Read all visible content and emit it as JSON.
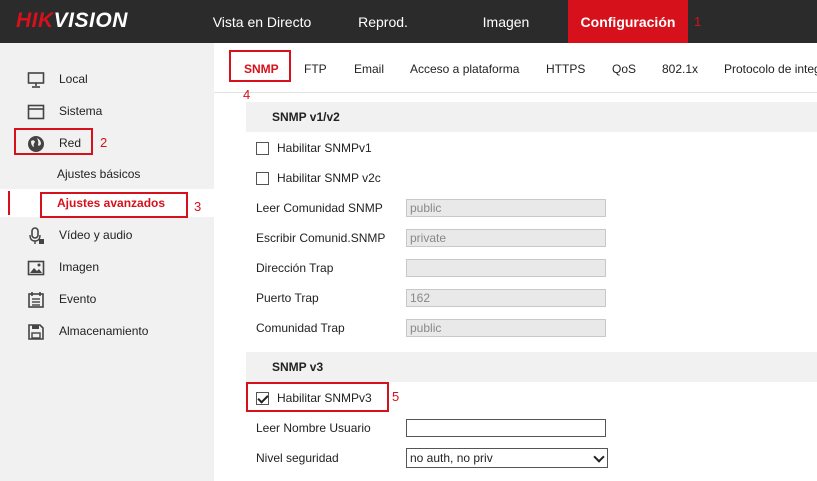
{
  "header": {
    "logo_red": "HIK",
    "logo_white": "VISION",
    "nav": [
      {
        "label": "Vista en Directo"
      },
      {
        "label": "Reprod."
      },
      {
        "label": "Imagen"
      },
      {
        "label": "Configuración"
      }
    ]
  },
  "annotations": [
    "1",
    "2",
    "3",
    "4",
    "5"
  ],
  "sidebar": {
    "items": [
      {
        "label": "Local"
      },
      {
        "label": "Sistema"
      },
      {
        "label": "Red"
      },
      {
        "label": "Vídeo y audio"
      },
      {
        "label": "Imagen"
      },
      {
        "label": "Evento"
      },
      {
        "label": "Almacenamiento"
      }
    ],
    "subitems": [
      {
        "label": "Ajustes básicos"
      },
      {
        "label": "Ajustes avanzados"
      }
    ]
  },
  "tabs": [
    {
      "label": "SNMP"
    },
    {
      "label": "FTP"
    },
    {
      "label": "Email"
    },
    {
      "label": "Acceso a plataforma"
    },
    {
      "label": "HTTPS"
    },
    {
      "label": "QoS"
    },
    {
      "label": "802.1x"
    },
    {
      "label": "Protocolo de integ"
    }
  ],
  "snmp_v1v2": {
    "title": "SNMP v1/v2",
    "enable_v1": {
      "label": "Habilitar SNMPv1",
      "checked": false
    },
    "enable_v2c": {
      "label": "Habilitar SNMP v2c",
      "checked": false
    },
    "read_community": {
      "label": "Leer Comunidad SNMP",
      "value": "public"
    },
    "write_community": {
      "label": "Escribir Comunid.SNMP",
      "value": "private"
    },
    "trap_address": {
      "label": "Dirección Trap",
      "value": ""
    },
    "trap_port": {
      "label": "Puerto Trap",
      "value": "162"
    },
    "trap_community": {
      "label": "Comunidad Trap",
      "value": "public"
    }
  },
  "snmp_v3": {
    "title": "SNMP v3",
    "enable_v3": {
      "label": "Habilitar SNMPv3",
      "checked": true
    },
    "read_username": {
      "label": "Leer Nombre Usuario",
      "value": ""
    },
    "security_level": {
      "label": "Nivel seguridad",
      "value": "no auth, no priv"
    }
  },
  "colors": {
    "accent": "#d7111b",
    "topbar": "#2b2b2b",
    "sidebar": "#f1f1f1"
  }
}
